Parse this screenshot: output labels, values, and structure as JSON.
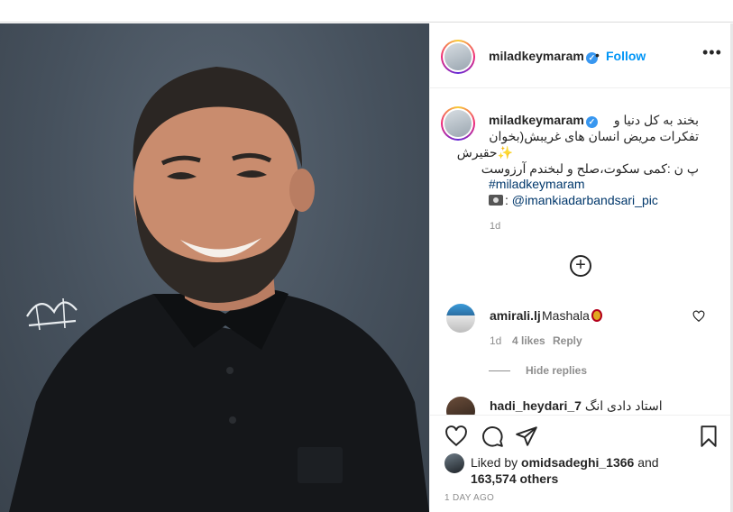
{
  "post": {
    "username": "miladkeymaram",
    "verified_mark": "✓",
    "separator": "•",
    "follow_label": "Follow",
    "more_label": "•••"
  },
  "caption": {
    "username": "miladkeymaram",
    "line1": "بخند به کل دنیا و",
    "line2": "تفکرات مریض انسان های غریبش(بخوان",
    "line3": "✨حقیرش",
    "line4": "پ ن :کمی سکوت،صلح و لبخندم آرزوست",
    "hashtag": "#miladkeymaram",
    "credit_prefix": ":",
    "credit_handle": "@imankiadarbandsari_pic",
    "time": "1d"
  },
  "load_more_label": "+",
  "comments": [
    {
      "username": "amirali.lj",
      "text": "Mashala",
      "time": "1d",
      "likes": "4 likes",
      "reply": "Reply",
      "hide_replies": "Hide replies"
    },
    {
      "username": "hadi_heydari_7",
      "text": "استاد دادی انگ"
    }
  ],
  "likes": {
    "prefix": "Liked by",
    "user": "omidsadeghi_1366",
    "and": "and",
    "count": "163,574 others"
  },
  "date_label": "1 DAY AGO",
  "photo": {
    "watermark": "ایمان کیادربندسری"
  },
  "colors": {
    "accent": "#0095f6",
    "link": "#00376b",
    "muted": "#8e8e8e",
    "photo_bg": "#46515d"
  }
}
